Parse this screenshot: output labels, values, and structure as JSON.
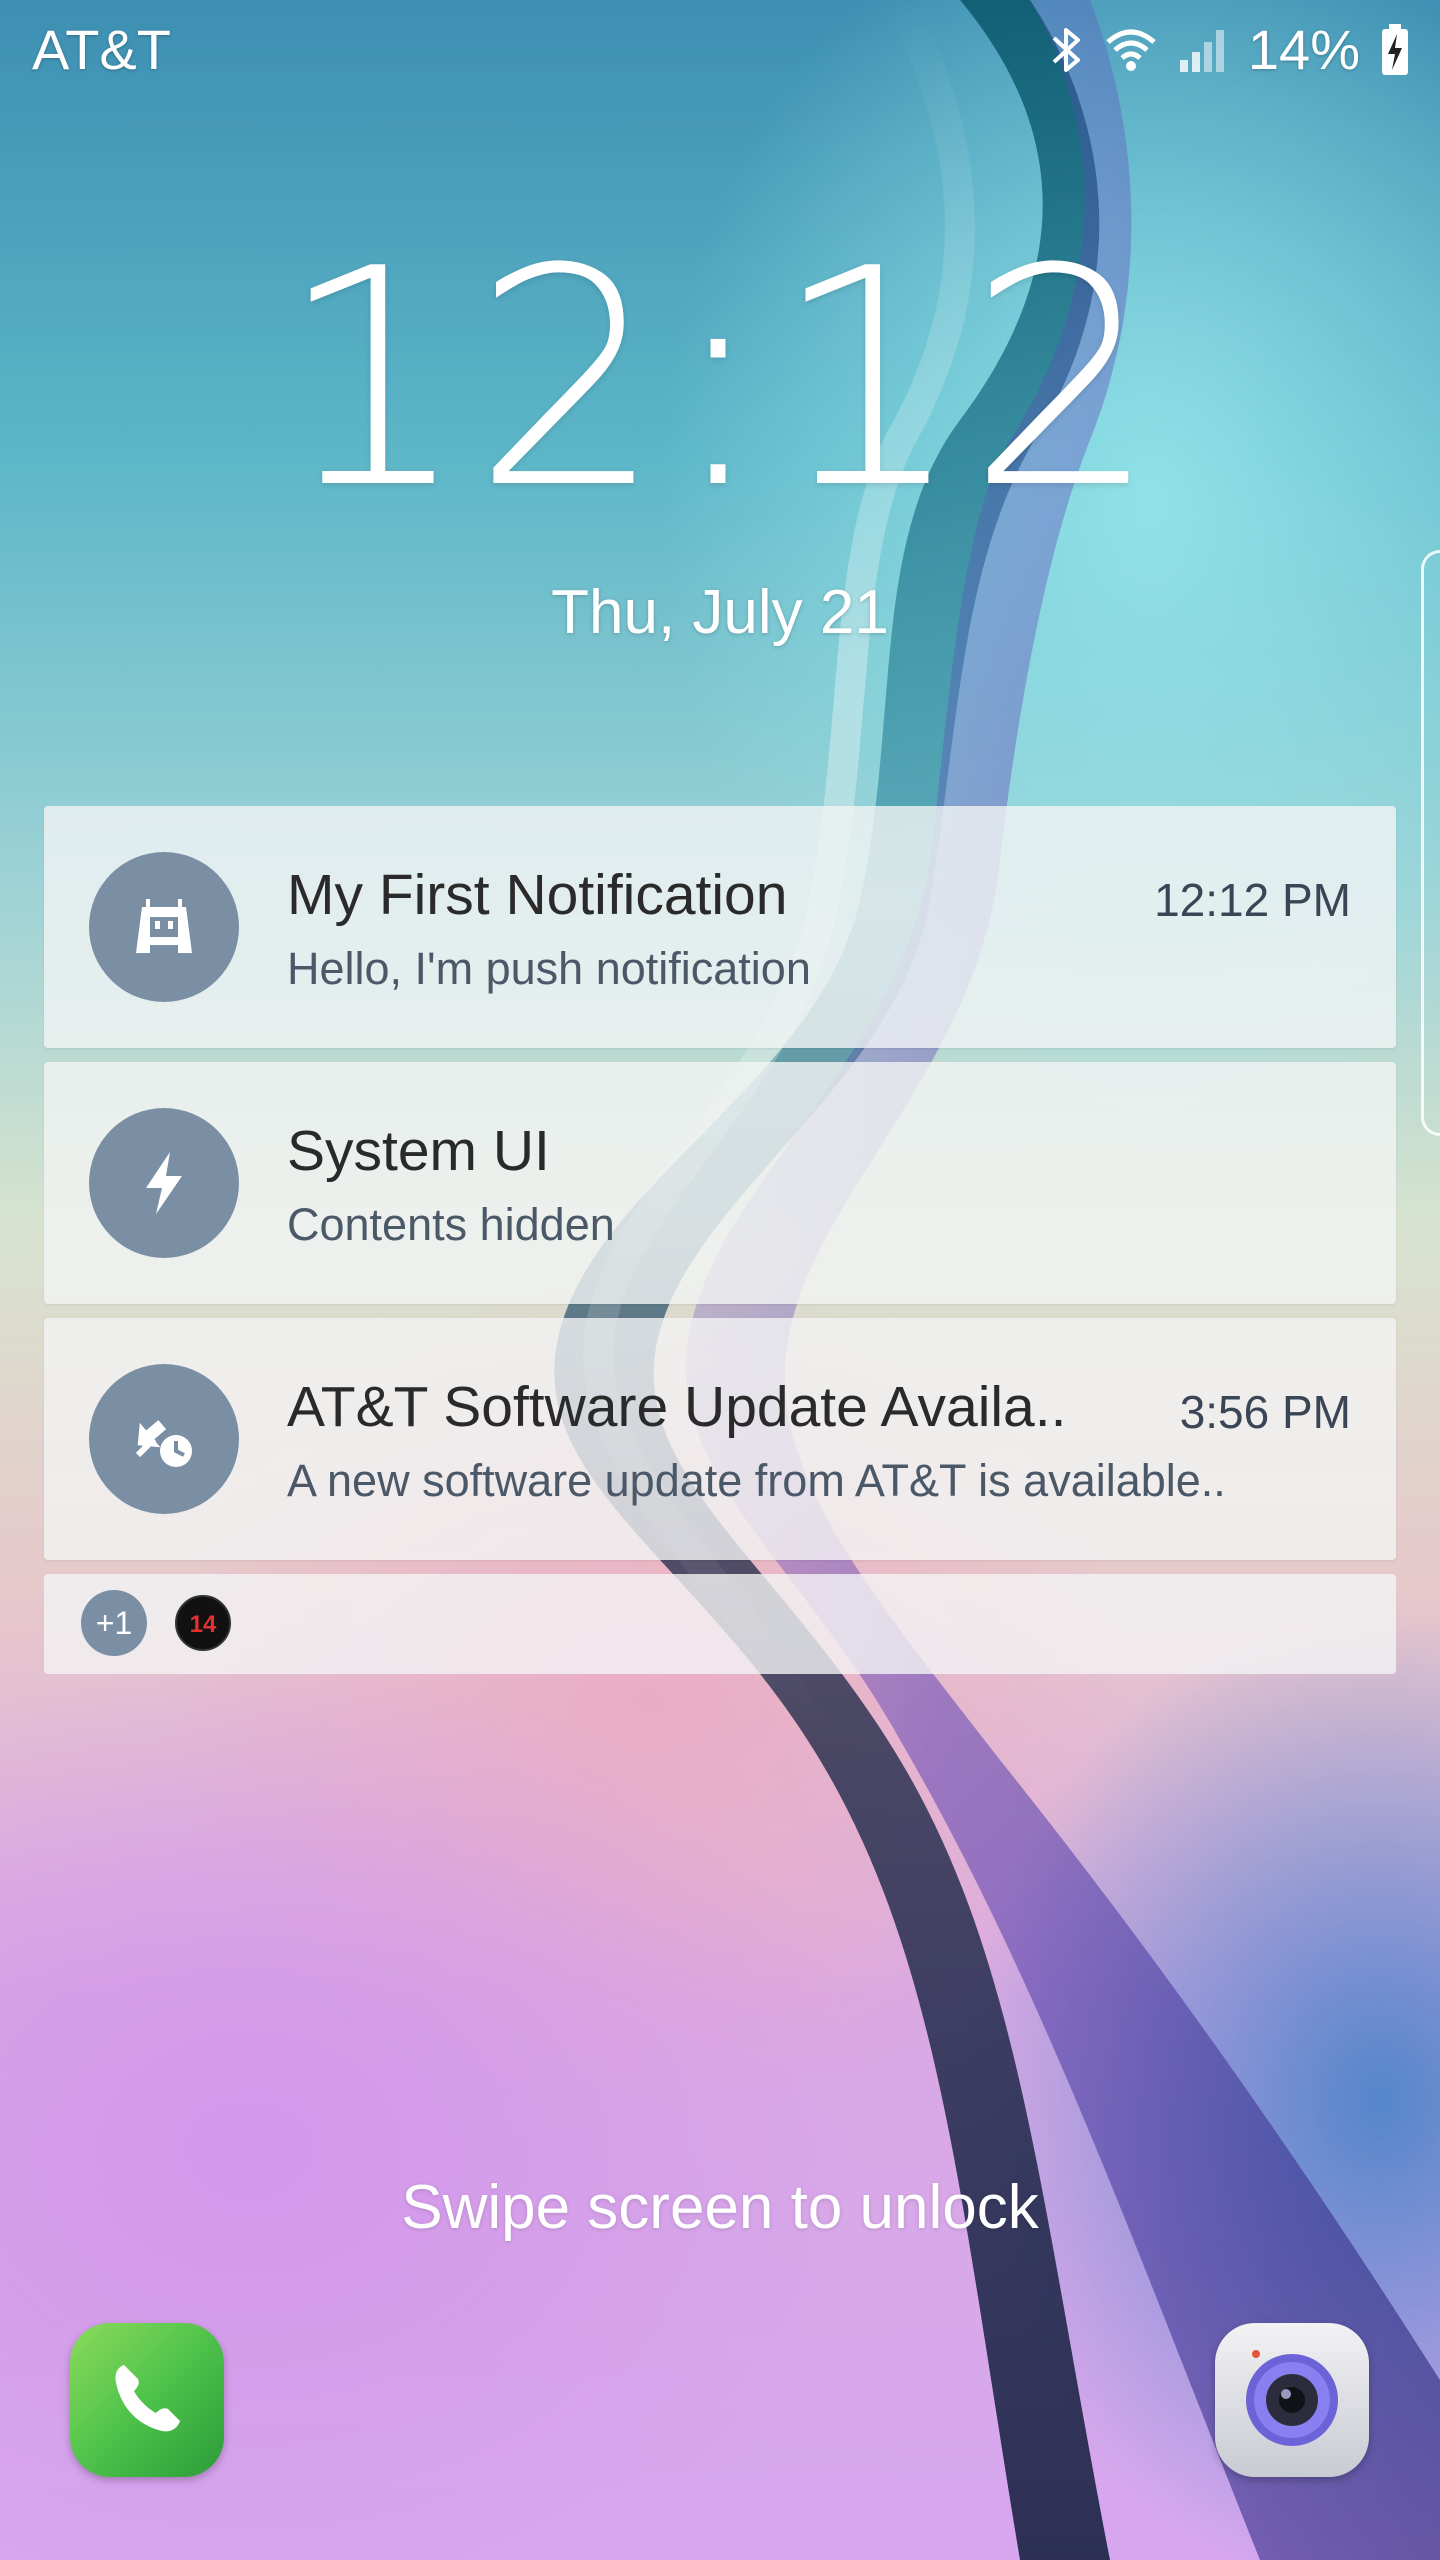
{
  "status_bar": {
    "carrier": "AT&T",
    "battery_percent": "14%",
    "icons": [
      "bluetooth-icon",
      "wifi-icon",
      "cell-signal-icon",
      "battery-charging-icon"
    ]
  },
  "lockscreen": {
    "time": "12:12",
    "date": "Thu, July 21",
    "unlock_hint": "Swipe screen to unlock"
  },
  "notifications": [
    {
      "icon": "cordova-robot-icon",
      "title": "My First Notification",
      "body": "Hello, I'm push notification",
      "time": "12:12 PM"
    },
    {
      "icon": "lightning-bolt-icon",
      "title": "System UI",
      "body": "Contents hidden",
      "time": ""
    },
    {
      "icon": "software-update-icon",
      "title": "AT&T Software Update Availa..",
      "body": "A new software update from AT&T is available..",
      "time": "3:56 PM"
    }
  ],
  "more_notifications": {
    "count_label": "+1",
    "mini_icon_label": "14"
  },
  "shortcuts": {
    "left": "phone-icon",
    "right": "camera-icon"
  },
  "colors": {
    "notification_icon_bg": "#7a8ea4",
    "notification_card_bg": "#f2f4f4",
    "phone_green": "#4ec24a"
  }
}
